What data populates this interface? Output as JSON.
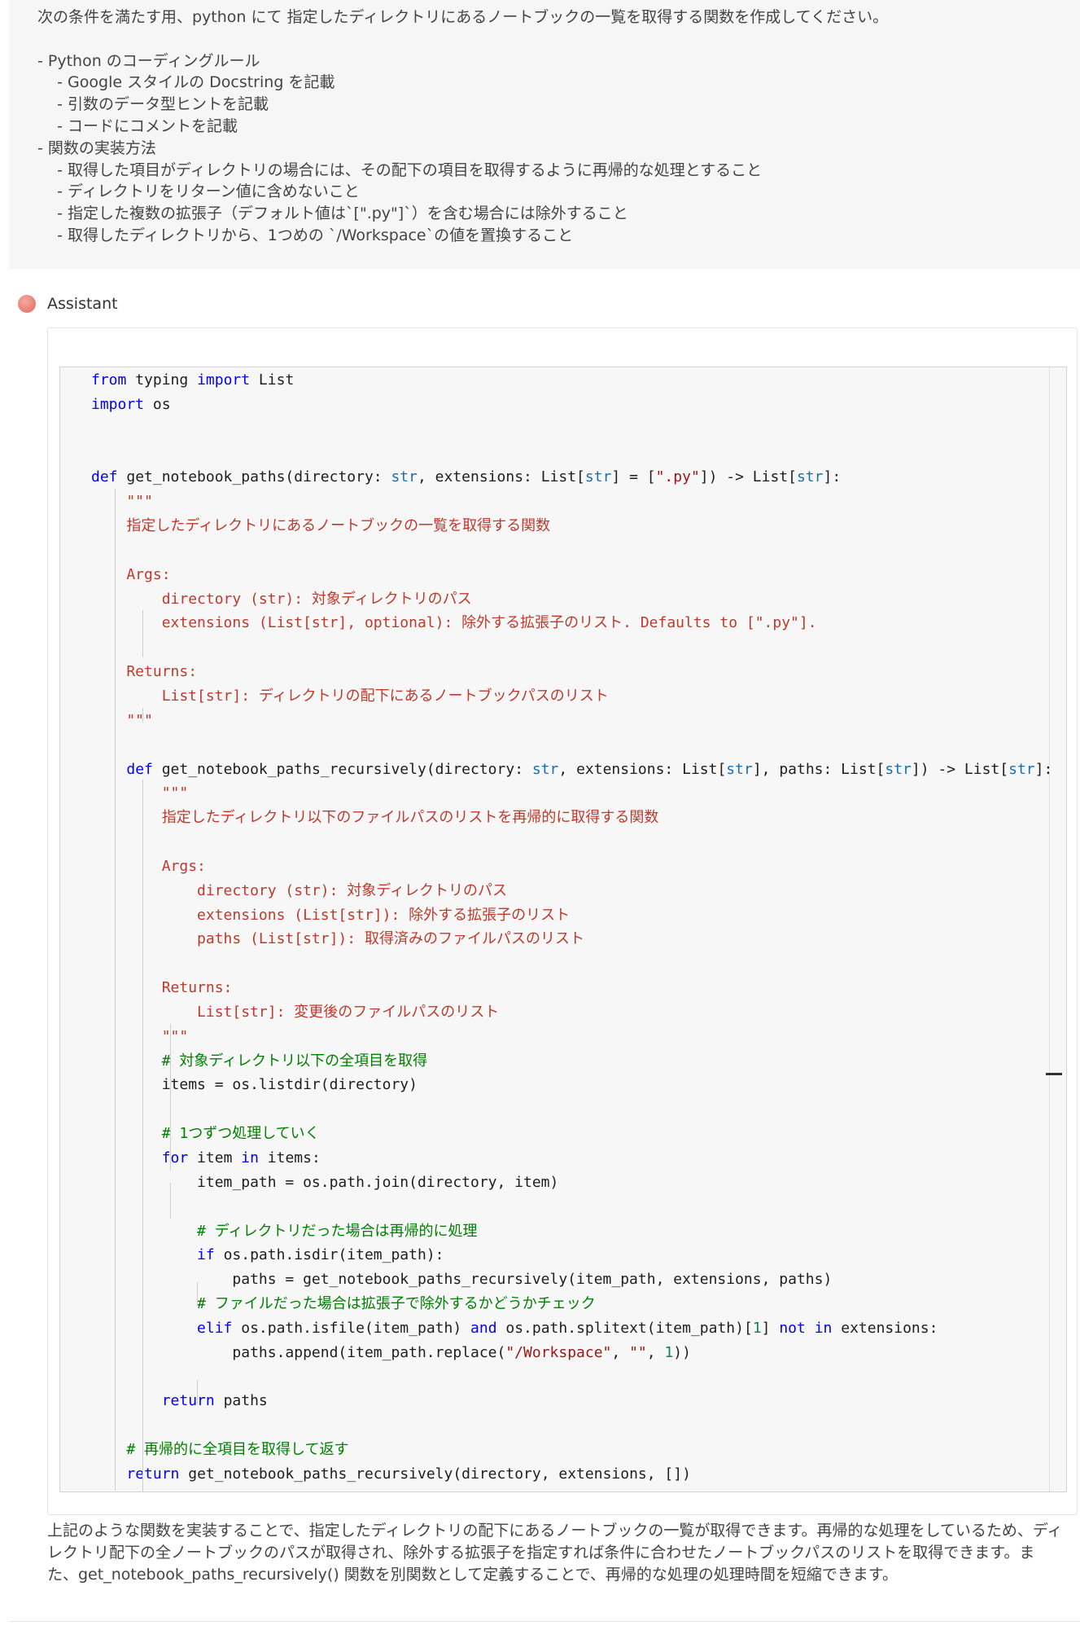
{
  "user_message": {
    "lines": [
      "次の条件を満たす用、python にて 指定したディレクトリにあるノートブックの一覧を取得する関数を作成してください。",
      "",
      "- Python のコーディングルール",
      "    - Google スタイルの Docstring を記載",
      "    - 引数のデータ型ヒントを記載",
      "    - コードにコメントを記載",
      "- 関数の実装方法",
      "    - 取得した項目がディレクトリの場合には、その配下の項目を取得するように再帰的な処理とすること",
      "    - ディレクトリをリターン値に含めないこと",
      "    - 指定した複数の拡張子（デフォルト値は`[\".py\"]`）を含む場合には除外すること",
      "    - 取得したディレクトリから、1つめの `/Workspace`の値を置換すること"
    ]
  },
  "assistant": {
    "role_label": "Assistant",
    "code_lines": [
      "from typing import List",
      "import os",
      "",
      "",
      "def get_notebook_paths(directory: str, extensions: List[str] = [\".py\"]) -> List[str]:",
      "    \"\"\"",
      "    指定したディレクトリにあるノートブックの一覧を取得する関数",
      "",
      "    Args:",
      "        directory (str): 対象ディレクトリのパス",
      "        extensions (List[str], optional): 除外する拡張子のリスト. Defaults to [\".py\"].",
      "",
      "    Returns:",
      "        List[str]: ディレクトリの配下にあるノートブックパスのリスト",
      "    \"\"\"",
      "",
      "    def get_notebook_paths_recursively(directory: str, extensions: List[str], paths: List[str]) -> List[str]:",
      "        \"\"\"",
      "        指定したディレクトリ以下のファイルパスのリストを再帰的に取得する関数",
      "",
      "        Args:",
      "            directory (str): 対象ディレクトリのパス",
      "            extensions (List[str]): 除外する拡張子のリスト",
      "            paths (List[str]): 取得済みのファイルパスのリスト",
      "",
      "        Returns:",
      "            List[str]: 変更後のファイルパスのリスト",
      "        \"\"\"",
      "        # 対象ディレクトリ以下の全項目を取得",
      "        items = os.listdir(directory)",
      "",
      "        # 1つずつ処理していく",
      "        for item in items:",
      "            item_path = os.path.join(directory, item)",
      "",
      "            # ディレクトリだった場合は再帰的に処理",
      "            if os.path.isdir(item_path):",
      "                paths = get_notebook_paths_recursively(item_path, extensions, paths)",
      "            # ファイルだった場合は拡張子で除外するかどうかチェック",
      "            elif os.path.isfile(item_path) and os.path.splitext(item_path)[1] not in extensions:",
      "                paths.append(item_path.replace(\"/Workspace\", \"\", 1))",
      "",
      "        return paths",
      "",
      "    # 再帰的に全項目を取得して返す",
      "    return get_notebook_paths_recursively(directory, extensions, [])"
    ],
    "summary": "上記のような関数を実装することで、指定したディレクトリの配下にあるノートブックの一覧が取得できます。再帰的な処理をしているため、ディレクトリ配下の全ノートブックのパスが取得され、除外する拡張子を指定すれば条件に合わせたノートブックパスのリストを取得できます。また、get_notebook_paths_recursively() 関数を別関数として定義することで、再帰的な処理の処理時間を短縮できます。"
  }
}
